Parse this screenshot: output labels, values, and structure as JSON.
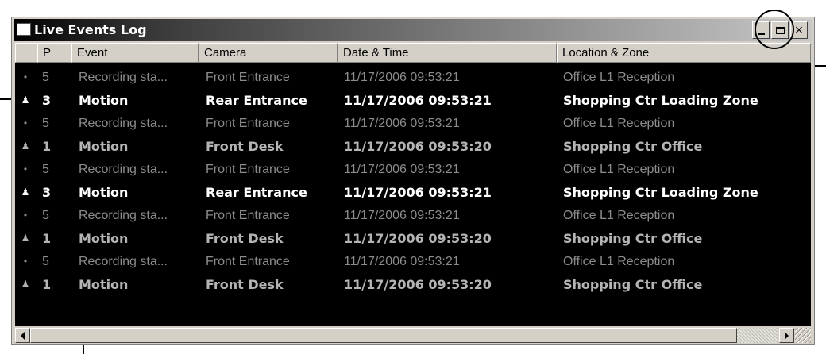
{
  "window": {
    "title": "Live Events Log",
    "controls": {
      "minimize": "_",
      "close": "×"
    }
  },
  "columns": [
    "",
    "P",
    "Event",
    "Camera",
    "Date & Time",
    "Location & Zone"
  ],
  "rows": [
    {
      "style": "dim",
      "icon": "•",
      "icon_name": "dot-icon",
      "p": "5",
      "event": "Recording sta...",
      "camera": "Front Entrance",
      "datetime": "11/17/2006 09:53:21",
      "location": "Office L1 Reception"
    },
    {
      "style": "white",
      "icon": "♟",
      "icon_name": "person-icon",
      "p": "3",
      "event": "Motion",
      "camera": "Rear Entrance",
      "datetime": "11/17/2006 09:53:21",
      "location": "Shopping Ctr Loading Zone"
    },
    {
      "style": "dim",
      "icon": "•",
      "icon_name": "dot-icon",
      "p": "5",
      "event": "Recording sta...",
      "camera": "Front Entrance",
      "datetime": "11/17/2006 09:53:21",
      "location": "Office L1 Reception"
    },
    {
      "style": "gray",
      "icon": "♟",
      "icon_name": "person-icon",
      "p": "1",
      "event": "Motion",
      "camera": "Front Desk",
      "datetime": "11/17/2006 09:53:20",
      "location": "Shopping Ctr Office"
    },
    {
      "style": "dim",
      "icon": "•",
      "icon_name": "dot-icon",
      "p": "5",
      "event": "Recording sta...",
      "camera": "Front Entrance",
      "datetime": "11/17/2006 09:53:21",
      "location": "Office L1 Reception"
    },
    {
      "style": "white",
      "icon": "♟",
      "icon_name": "person-icon",
      "p": "3",
      "event": "Motion",
      "camera": "Rear Entrance",
      "datetime": "11/17/2006 09:53:21",
      "location": "Shopping Ctr Loading Zone"
    },
    {
      "style": "dim",
      "icon": "•",
      "icon_name": "dot-icon",
      "p": "5",
      "event": "Recording sta...",
      "camera": "Front Entrance",
      "datetime": "11/17/2006 09:53:21",
      "location": "Office L1 Reception"
    },
    {
      "style": "gray",
      "icon": "♟",
      "icon_name": "person-icon",
      "p": "1",
      "event": "Motion",
      "camera": "Front Desk",
      "datetime": "11/17/2006 09:53:20",
      "location": "Shopping Ctr Office"
    },
    {
      "style": "dim",
      "icon": "•",
      "icon_name": "dot-icon",
      "p": "5",
      "event": "Recording sta...",
      "camera": "Front Entrance",
      "datetime": "11/17/2006 09:53:21",
      "location": "Office L1 Reception"
    },
    {
      "style": "gray",
      "icon": "♟",
      "icon_name": "person-icon",
      "p": "1",
      "event": "Motion",
      "camera": "Front Desk",
      "datetime": "11/17/2006 09:53:20",
      "location": "Shopping Ctr Office"
    }
  ],
  "colors": {
    "list_background": "#000000",
    "dim_text": "#8c8c8c",
    "bright_text": "#ffffff",
    "gray_text": "#b4b4b4",
    "chrome": "#d4d0c8"
  }
}
